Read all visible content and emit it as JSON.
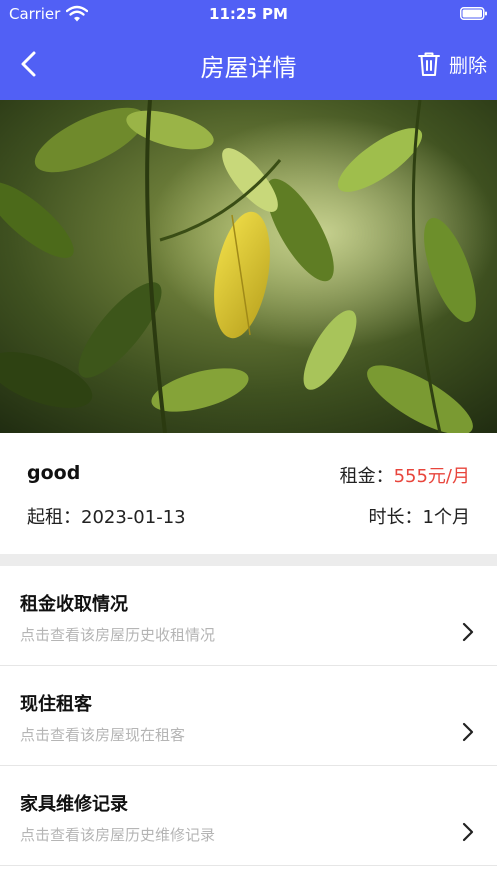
{
  "status_bar": {
    "carrier": "Carrier",
    "time": "11:25 PM"
  },
  "nav": {
    "title": "房屋详情",
    "delete_label": "删除"
  },
  "colors": {
    "accent": "#5160f5",
    "price": "#e8453c",
    "subtext": "#b5b5b5"
  },
  "house": {
    "name": "good",
    "rent_label": "租金：",
    "rent_value": "555元/月",
    "start_label": "起租：",
    "start_date": "2023-01-13",
    "duration_label": "时长：",
    "duration_value": "1个月"
  },
  "menu": [
    {
      "title": "租金收取情况",
      "subtitle": "点击查看该房屋历史收租情况",
      "icon": "chevron-right-icon"
    },
    {
      "title": "现住租客",
      "subtitle": "点击查看该房屋现在租客",
      "icon": "chevron-right-icon"
    },
    {
      "title": "家具维修记录",
      "subtitle": "点击查看该房屋历史维修记录",
      "icon": "chevron-right-icon"
    }
  ]
}
